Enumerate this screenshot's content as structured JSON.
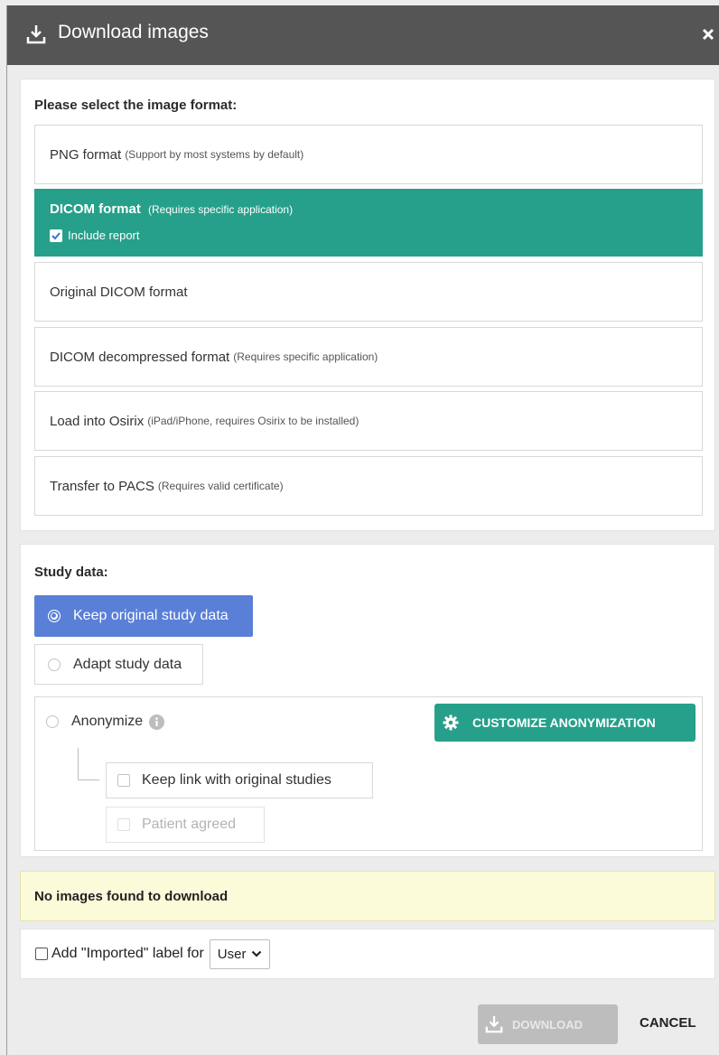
{
  "dialog": {
    "title": "Download images"
  },
  "format_section": {
    "heading": "Please select the image format:",
    "options": [
      {
        "label": "PNG format",
        "sub": "(Support by most systems by default)"
      },
      {
        "label": "DICOM format",
        "sub": "(Requires specific application)",
        "selected": true,
        "include_report_label": "Include report",
        "include_report_checked": true
      },
      {
        "label": "Original DICOM format",
        "sub": ""
      },
      {
        "label": "DICOM decompressed format",
        "sub": "(Requires specific application)"
      },
      {
        "label": "Load into Osirix",
        "sub": "(iPad/iPhone, requires Osirix to be installed)"
      },
      {
        "label": "Transfer to PACS",
        "sub": "(Requires valid certificate)"
      }
    ]
  },
  "study_section": {
    "heading": "Study data:",
    "keep_original": "Keep original study data",
    "adapt": "Adapt study data",
    "anonymize": "Anonymize",
    "customize_button": "CUSTOMIZE ANONYMIZATION",
    "keep_link": "Keep link with original studies",
    "patient_agreed": "Patient agreed"
  },
  "warning": "No images found to download",
  "label_row": {
    "text": "Add \"Imported\" label for",
    "select_value": "User"
  },
  "footer": {
    "download": "DOWNLOAD",
    "cancel": "CANCEL"
  },
  "colors": {
    "header": "#555555",
    "teal": "#26a08a",
    "blue": "#5a7fd6",
    "warning_bg": "#fcfbd9"
  }
}
